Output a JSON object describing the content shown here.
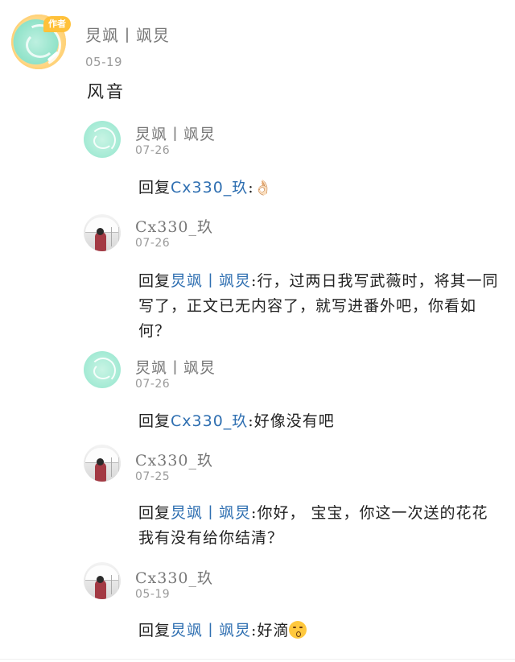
{
  "main_comment": {
    "badge": "作者",
    "username": "炅飒丨飒炅",
    "date": "05-19",
    "content": "风音"
  },
  "replies": [
    {
      "username": "炅飒丨飒炅",
      "date": "07-26",
      "reply_prefix": "回复",
      "mention": "Cx330_玖",
      "separator": ":",
      "text": "",
      "emoji": "👌🏻",
      "avatar_icon": "leaf-avatar"
    },
    {
      "username": "Cx330_玖",
      "date": "07-26",
      "reply_prefix": "回复",
      "mention": "炅飒丨飒炅",
      "separator": ":",
      "text": "行，过两日我写武薇时，将其一同写了，正文已无内容了，就写进番外吧，你看如何？",
      "avatar_icon": "umbrella-girl-avatar"
    },
    {
      "username": "炅飒丨飒炅",
      "date": "07-26",
      "reply_prefix": "回复",
      "mention": "Cx330_玖",
      "separator": ":",
      "text": "好像没有吧",
      "avatar_icon": "leaf-avatar"
    },
    {
      "username": "Cx330_玖",
      "date": "07-25",
      "reply_prefix": "回复",
      "mention": "炅飒丨飒炅",
      "separator": ":",
      "text": "你好， 宝宝，你这一次送的花花 我有没有给你结清？",
      "avatar_icon": "umbrella-girl-avatar"
    },
    {
      "username": "Cx330_玖",
      "date": "05-19",
      "reply_prefix": "回复",
      "mention": "炅飒丨飒炅",
      "separator": ":",
      "text": "好滴",
      "emoji": "kissing-face",
      "avatar_icon": "umbrella-girl-avatar"
    }
  ],
  "colors": {
    "mention": "#2f6fb1",
    "username": "#777777",
    "date": "#9a9a9a",
    "badge": "#ffc13a"
  }
}
